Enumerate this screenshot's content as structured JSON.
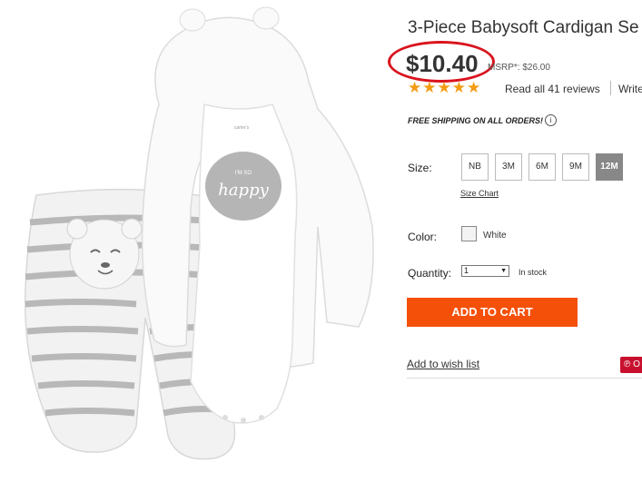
{
  "product": {
    "title": "3-Piece Babysoft Cardigan Se",
    "price": "$10.40",
    "msrp": "MSRP*: $26.00",
    "rating_stars": "★★★★★",
    "reviews_link": "Read all 41 reviews",
    "write_link": "Write",
    "shipping": "FREE SHIPPING ON ALL ORDERS!",
    "info_icon": "i",
    "onesie_text_small": "I'M SO",
    "onesie_text": "happy",
    "tag_text": "carter's"
  },
  "size": {
    "label": "Size:",
    "options": [
      "NB",
      "3M",
      "6M",
      "9M",
      "12M"
    ],
    "selected": "12M",
    "chart_link": "Size Chart"
  },
  "color": {
    "label": "Color:",
    "value": "White",
    "swatch": "#f3f3f3"
  },
  "quantity": {
    "label": "Quantity:",
    "value": "1",
    "arrow": "▼",
    "stock": "In stock"
  },
  "actions": {
    "add_to_cart": "ADD TO CART",
    "wish_list": "Add to wish list",
    "pin_label": "℗ O"
  },
  "colors": {
    "accent": "#f5500a",
    "highlight_circle": "#d9141e",
    "stars": "#f39c12"
  }
}
